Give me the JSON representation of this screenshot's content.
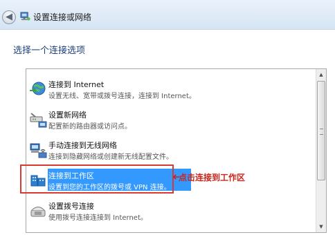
{
  "window": {
    "title": "设置连接或网络",
    "back_symbol": "◀"
  },
  "heading": "选择一个连接选项",
  "options": [
    {
      "title": "连接到 Internet",
      "desc": "设置无线、宽带或拨号连接，连接到 Internet。",
      "icon": "globe-connect-icon",
      "selected": false
    },
    {
      "title": "设置新网络",
      "desc": "配置新的路由器或访问点。",
      "icon": "router-network-icon",
      "selected": false
    },
    {
      "title": "手动连接到无线网络",
      "desc": "连接到隐藏网络或创建新无线配置文件。",
      "icon": "wireless-network-icon",
      "selected": false
    },
    {
      "title": "连接到工作区",
      "desc": "设置到您的工作区的拨号或 VPN 连接。",
      "icon": "workplace-icon",
      "selected": true
    },
    {
      "title": "设置拨号连接",
      "desc": "使用拨号连接连接到 Internet。",
      "icon": "dialup-phone-icon",
      "selected": false
    }
  ],
  "scrollbar": {
    "up_symbol": "▲",
    "down_symbol": "▼"
  },
  "annotation": {
    "text": "点击连接到工作区",
    "color": "#cc2419"
  },
  "colors": {
    "selection": "#3399ff",
    "heading": "#1a3f7a",
    "annotation_border": "#d83a31"
  }
}
